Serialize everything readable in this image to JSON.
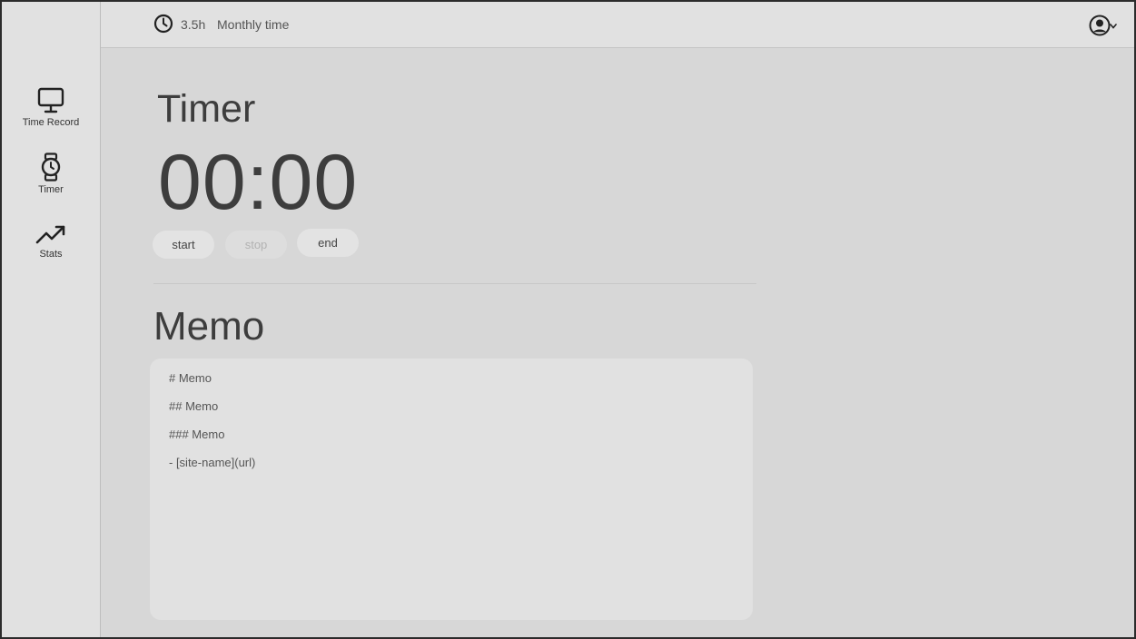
{
  "sidebar": {
    "items": [
      {
        "label": "Time Record",
        "icon": "monitor-icon"
      },
      {
        "label": "Timer",
        "icon": "watch-icon"
      },
      {
        "label": "Stats",
        "icon": "trending-up-icon"
      }
    ]
  },
  "header": {
    "hours": "3.5h",
    "monthly_label": "Monthly time",
    "clock_icon": "clock-icon",
    "user_icon": "user-circle-icon",
    "caret_icon": "chevron-down-icon"
  },
  "timer": {
    "title": "Timer",
    "display": "00:00",
    "buttons": {
      "start": "start",
      "stop": "stop",
      "end": "end"
    }
  },
  "memo": {
    "title": "Memo",
    "lines": [
      "# Memo",
      "## Memo",
      "### Memo",
      "- [site-name](url)"
    ]
  },
  "colors": {
    "background": "#d7d7d7",
    "panel": "#e1e1e1",
    "text": "#3d3d3d",
    "disabled": "#b2b2b2"
  }
}
